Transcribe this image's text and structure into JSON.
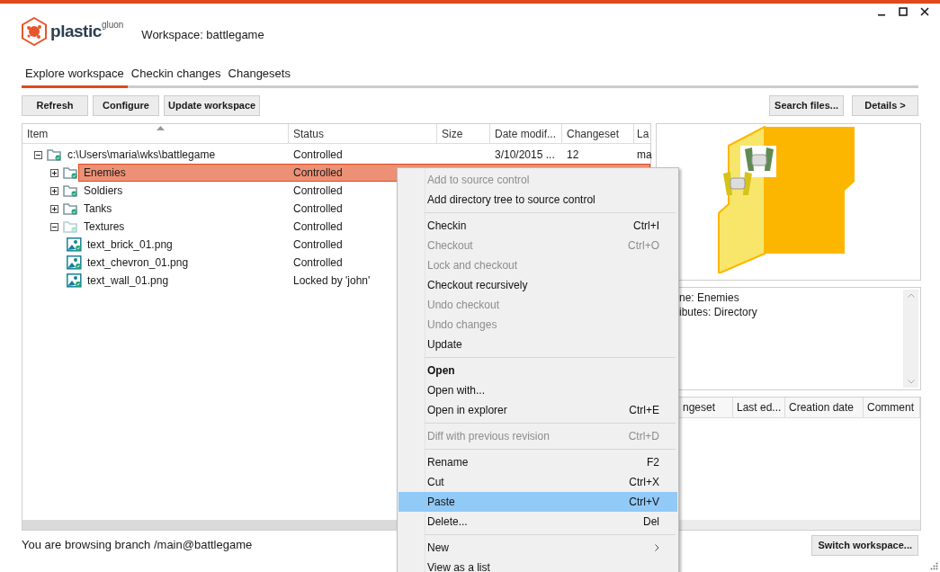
{
  "app": {
    "logo": "plastic",
    "logo_suffix": "gluon",
    "workspace_title": "Workspace: battlegame"
  },
  "tabs": [
    {
      "label": "Explore workspace",
      "selected": true
    },
    {
      "label": "Checkin changes",
      "selected": false
    },
    {
      "label": "Changesets",
      "selected": false
    }
  ],
  "toolbar": {
    "left": [
      "Refresh",
      "Configure",
      "Update workspace"
    ],
    "right": [
      "Search files...",
      "Details >"
    ]
  },
  "table": {
    "columns": [
      "Item",
      "Status",
      "Size",
      "Date modif...",
      "Changeset",
      "La"
    ],
    "rows": [
      {
        "kind": "folder",
        "name": "c:\\Users\\maria\\wks\\battlegame",
        "status": "Controlled",
        "size": "",
        "date": "3/10/2015 ...",
        "changeset": "12",
        "column_6": "ma",
        "expanded": true,
        "selected": false,
        "dim": false,
        "children": [
          {
            "kind": "folder",
            "name": "Enemies",
            "status": "Controlled",
            "expanded": false,
            "selected": true,
            "dim": false
          },
          {
            "kind": "folder",
            "name": "Soldiers",
            "status": "Controlled",
            "expanded": false,
            "selected": false,
            "dim": false
          },
          {
            "kind": "folder",
            "name": "Tanks",
            "status": "Controlled",
            "expanded": false,
            "selected": false,
            "dim": false
          },
          {
            "kind": "folder",
            "name": "Textures",
            "status": "Controlled",
            "expanded": true,
            "selected": false,
            "dim": true,
            "children": [
              {
                "kind": "image",
                "name": "text_brick_01.png",
                "status": "Controlled",
                "selected": false
              },
              {
                "kind": "image",
                "name": "text_chevron_01.png",
                "status": "Controlled",
                "selected": false
              },
              {
                "kind": "image",
                "name": "text_wall_01.png",
                "status": "Locked by 'john'",
                "selected": false
              }
            ]
          }
        ]
      }
    ]
  },
  "details": {
    "lines": [
      "ne: Enemies",
      "ibutes: Directory"
    ]
  },
  "history": {
    "columns": [
      "ngeset",
      "Last ed...",
      "Creation date",
      "Comment"
    ]
  },
  "status_bar": {
    "text": "You are browsing branch /main@battlegame",
    "button": "Switch workspace..."
  },
  "context_menu": [
    {
      "kind": "item",
      "label": "Add to source control",
      "disabled": true
    },
    {
      "kind": "item",
      "label": "Add directory tree to source control",
      "disabled": false
    },
    {
      "kind": "separator"
    },
    {
      "kind": "item",
      "label": "Checkin",
      "shortcut": "Ctrl+I",
      "disabled": false
    },
    {
      "kind": "item",
      "label": "Checkout",
      "shortcut": "Ctrl+O",
      "disabled": true
    },
    {
      "kind": "item",
      "label": "Lock and checkout",
      "disabled": true
    },
    {
      "kind": "item",
      "label": "Checkout recursively",
      "disabled": false
    },
    {
      "kind": "item",
      "label": "Undo checkout",
      "disabled": true
    },
    {
      "kind": "item",
      "label": "Undo changes",
      "disabled": true
    },
    {
      "kind": "item",
      "label": "Update",
      "disabled": false
    },
    {
      "kind": "separator"
    },
    {
      "kind": "item",
      "label": "Open",
      "disabled": false,
      "bold": true
    },
    {
      "kind": "item",
      "label": "Open with...",
      "disabled": false
    },
    {
      "kind": "item",
      "label": "Open in explorer",
      "shortcut": "Ctrl+E",
      "disabled": false
    },
    {
      "kind": "separator"
    },
    {
      "kind": "item",
      "label": "Diff with previous revision",
      "shortcut": "Ctrl+D",
      "disabled": true
    },
    {
      "kind": "separator"
    },
    {
      "kind": "item",
      "label": "Rename",
      "shortcut": "F2",
      "disabled": false
    },
    {
      "kind": "item",
      "label": "Cut",
      "shortcut": "Ctrl+X",
      "disabled": false
    },
    {
      "kind": "item",
      "label": "Paste",
      "shortcut": "Ctrl+V",
      "disabled": false,
      "selected": true
    },
    {
      "kind": "item",
      "label": "Delete...",
      "shortcut": "Del",
      "disabled": false
    },
    {
      "kind": "separator"
    },
    {
      "kind": "item",
      "label": "New",
      "submenu": true,
      "disabled": false
    },
    {
      "kind": "item",
      "label": "View as a list",
      "disabled": false
    }
  ]
}
